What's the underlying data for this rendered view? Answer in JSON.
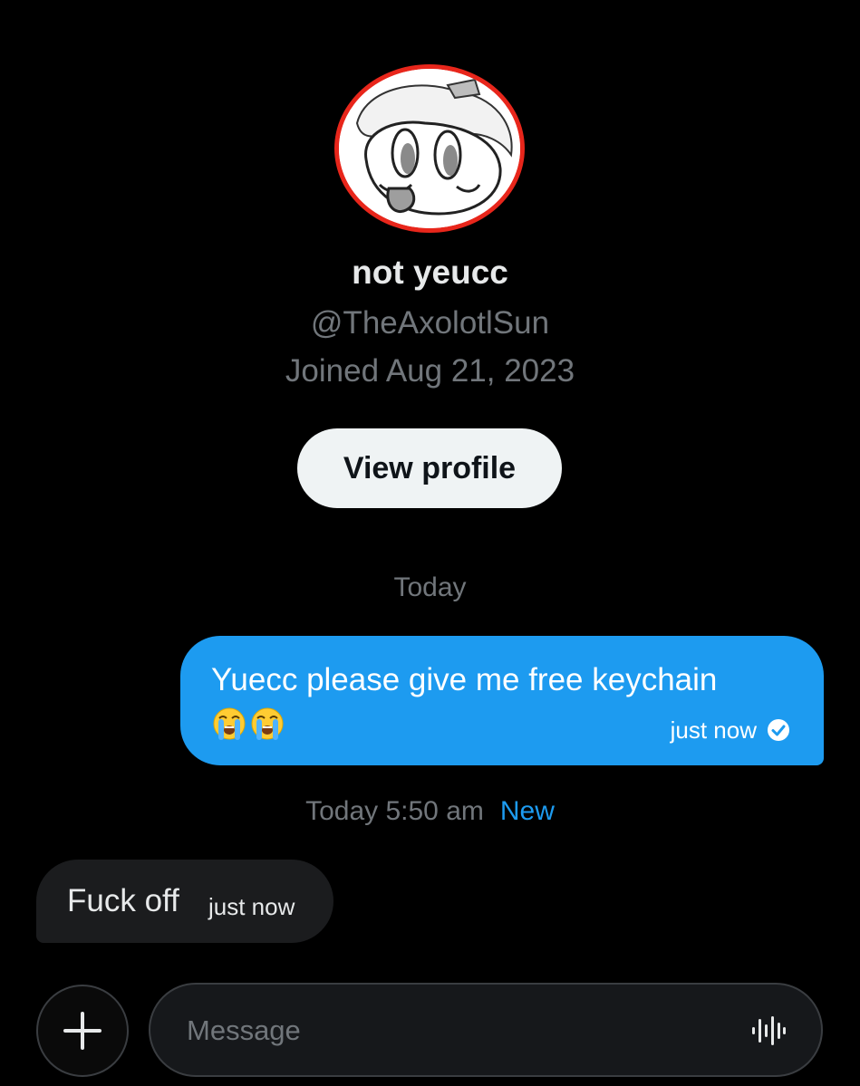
{
  "profile": {
    "display_name": "not yeucc",
    "handle": "@TheAxolotlSun",
    "joined": "Joined Aug 21, 2023",
    "view_profile_label": "View profile"
  },
  "conversation": {
    "date_separator": "Today",
    "messages": [
      {
        "direction": "sent",
        "text": "Yuecc please give me free keychain",
        "emojis": [
          "loudly-crying-face",
          "loudly-crying-face"
        ],
        "time": "just now",
        "status_icon": "read-check-icon"
      },
      {
        "direction": "received",
        "text": "Fuck off",
        "time": "just now"
      }
    ],
    "unread_marker": {
      "time": "Today 5:50 am",
      "label": "New"
    }
  },
  "composer": {
    "placeholder": "Message",
    "add_icon": "plus-icon",
    "voice_icon": "voice-waveform-icon"
  },
  "colors": {
    "background": "#000000",
    "sent_bubble": "#1d9bf0",
    "received_bubble": "#1b1c1e",
    "accent": "#1d9bf0",
    "muted_text": "#71767b",
    "avatar_border": "#e8261b"
  }
}
